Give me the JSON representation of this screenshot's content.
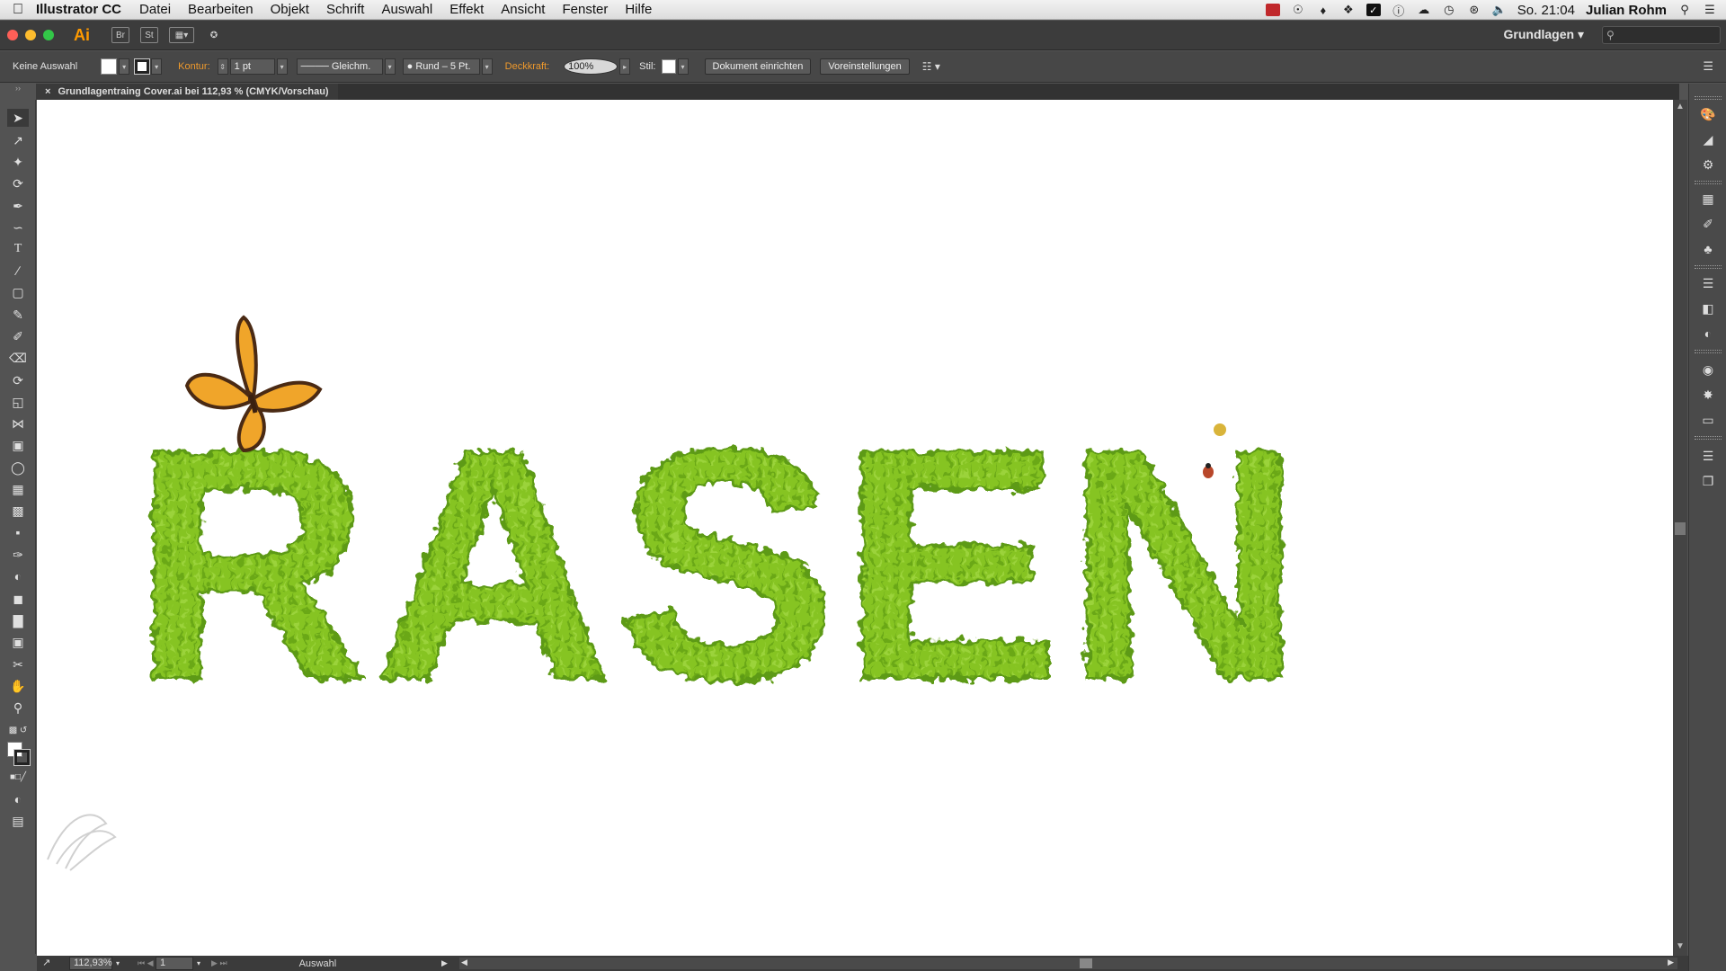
{
  "menubar": {
    "app_name": "Illustrator CC",
    "items": [
      "Datei",
      "Bearbeiten",
      "Objekt",
      "Schrift",
      "Auswahl",
      "Effekt",
      "Ansicht",
      "Fenster",
      "Hilfe"
    ],
    "clock": "So. 21:04",
    "user": "Julian Rohm"
  },
  "appbar": {
    "logo": "Ai",
    "bridge": "Br",
    "stock": "St",
    "workspace": "Grundlagen"
  },
  "control": {
    "selection": "Keine Auswahl",
    "kontur_label": "Kontur:",
    "kontur_value": "1 pt",
    "stroke_profile": "Gleichm.",
    "brush": "Rund – 5 Pt.",
    "opacity_label": "Deckkraft:",
    "opacity_value": "100%",
    "style_label": "Stil:",
    "doc_setup": "Dokument einrichten",
    "preferences": "Voreinstellungen"
  },
  "document": {
    "tab_title": "Grundlagentraing Cover.ai bei 112,93 % (CMYK/Vorschau)",
    "artwork_text": "RASEN"
  },
  "status": {
    "zoom": "112,93%",
    "page": "1",
    "mode": "Auswahl"
  },
  "colors": {
    "grass": "#7fbf1f",
    "grass_dark": "#5d9a12",
    "butterfly": "#f0a52a",
    "accent": "#f09a2c"
  }
}
